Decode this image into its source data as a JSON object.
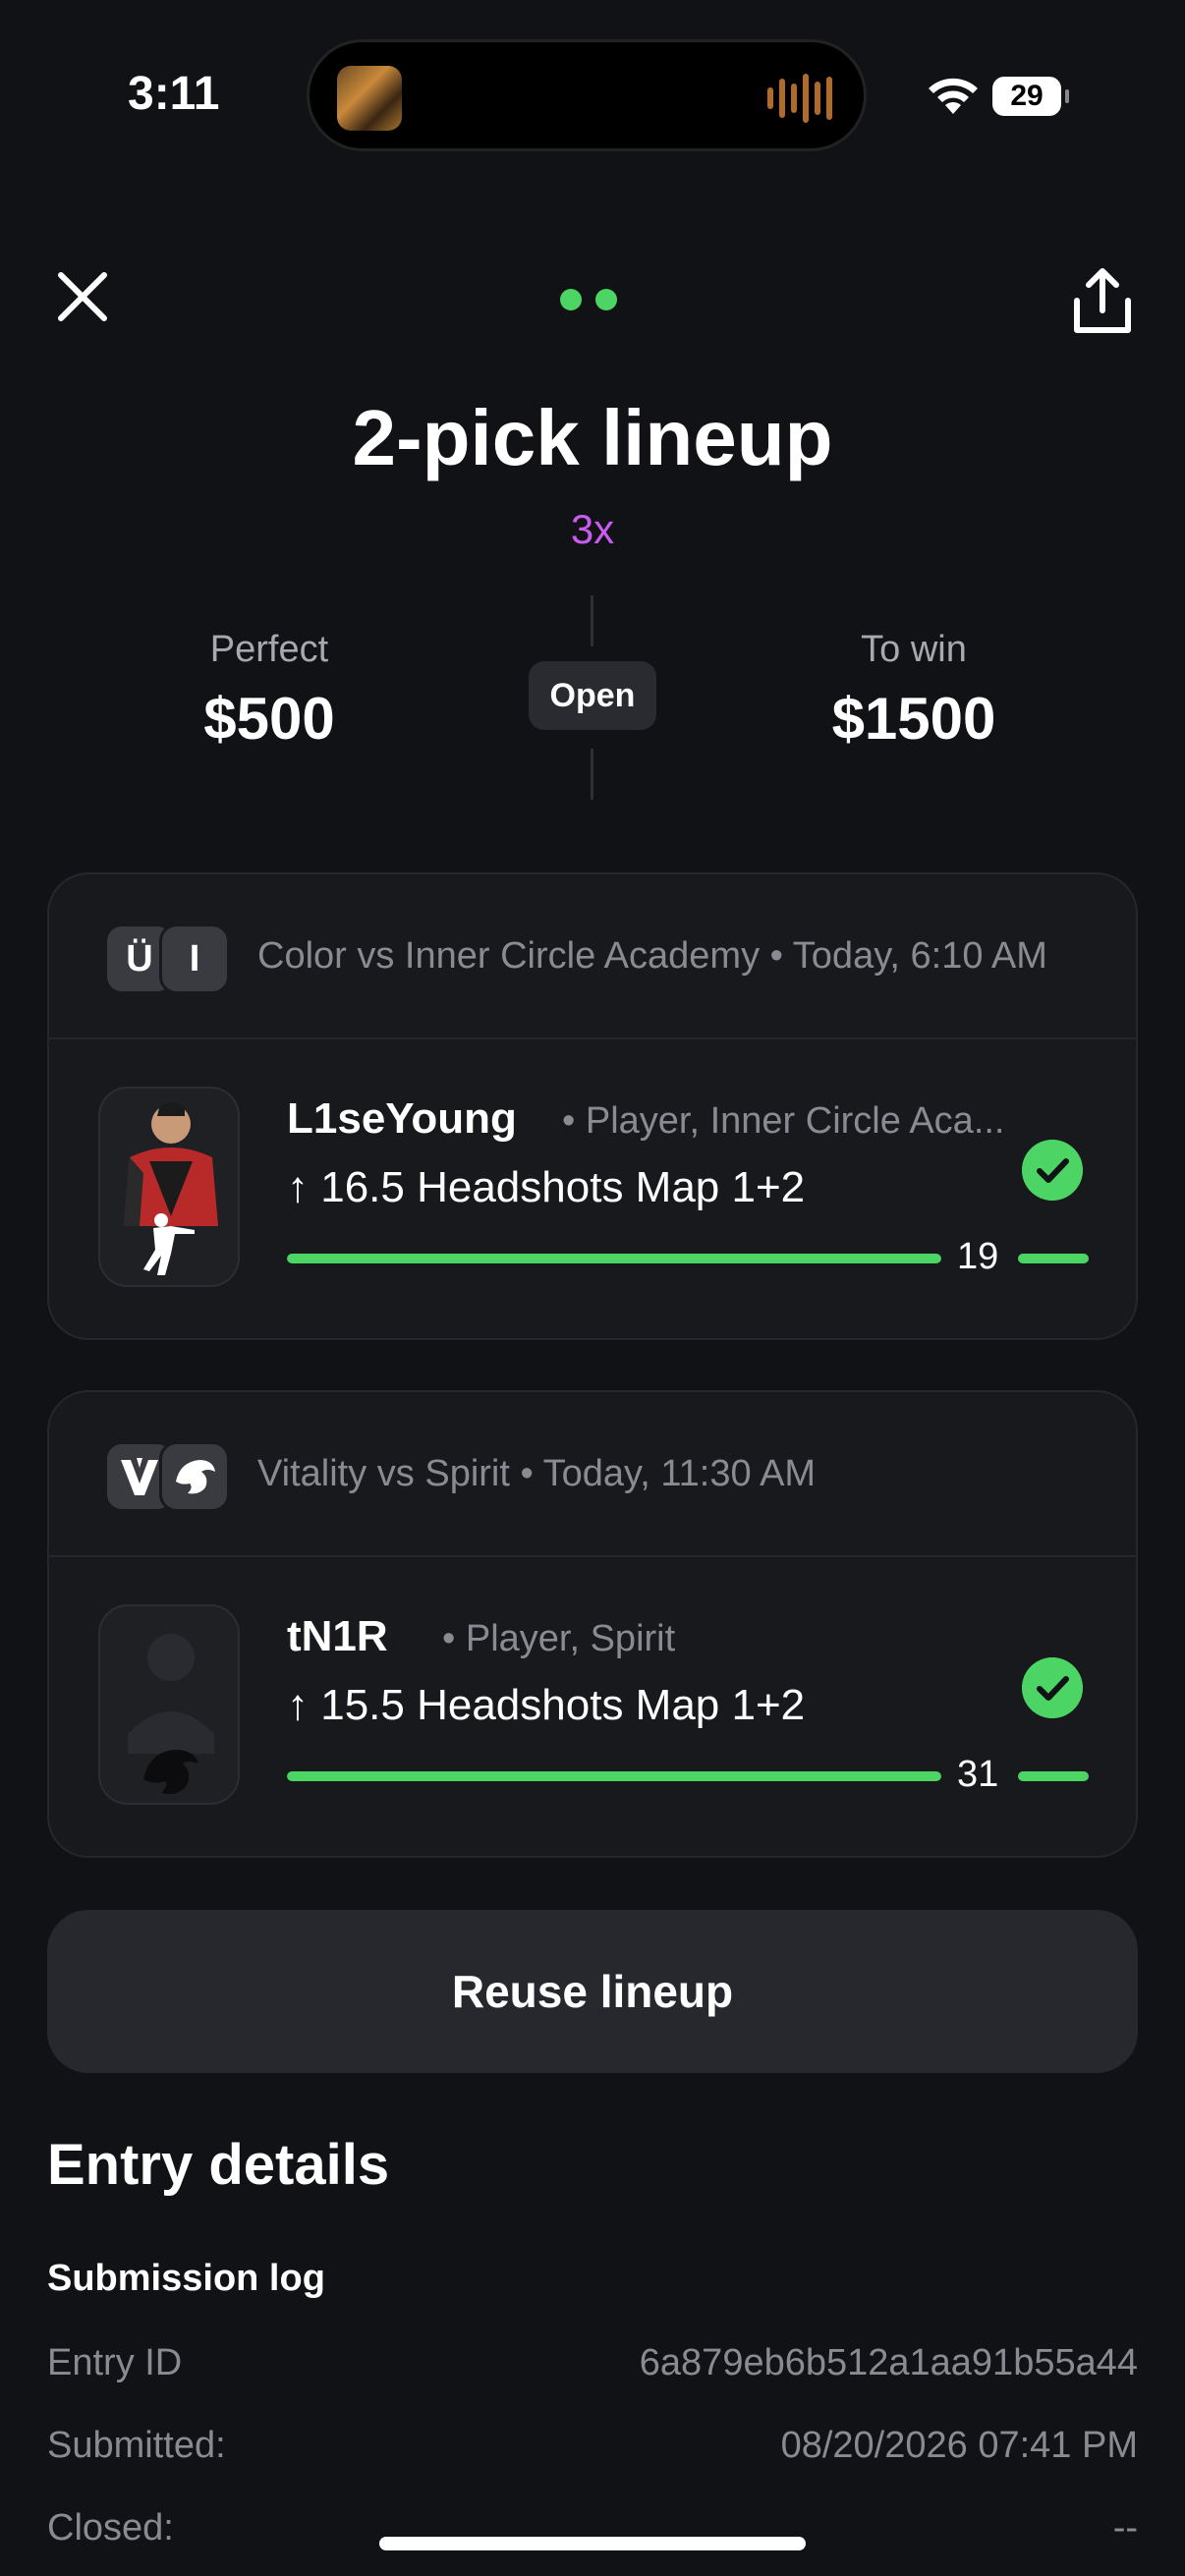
{
  "status_bar": {
    "time": "3:11",
    "battery": "29"
  },
  "header": {
    "title": "2-pick lineup",
    "multiplier": "3x"
  },
  "stats": {
    "perfect_label": "Perfect",
    "perfect_value": "$500",
    "status": "Open",
    "to_win_label": "To win",
    "to_win_value": "$1500"
  },
  "picks": [
    {
      "match": "Color vs Inner Circle Academy • Today, 6:10 AM",
      "team_logos": [
        "Ü",
        "I"
      ],
      "player": "L1seYoung",
      "meta": "• Player, Inner Circle Aca...",
      "prop": "↑ 16.5 Headshots Map 1+2",
      "result": "19",
      "progress_fraction": 1.0,
      "hit": true
    },
    {
      "match": "Vitality vs Spirit • Today, 11:30 AM",
      "team_logos": [
        "vitality-logo-icon",
        "spirit-dragon-icon"
      ],
      "player": "tN1R",
      "meta": "• Player, Spirit",
      "prop": "↑ 15.5 Headshots Map 1+2",
      "result": "31",
      "progress_fraction": 1.0,
      "hit": true
    }
  ],
  "actions": {
    "reuse_label": "Reuse lineup"
  },
  "entry_details": {
    "title": "Entry details",
    "log_title": "Submission log",
    "rows": [
      {
        "label": "Entry ID",
        "value": "6a879eb6b512a1aa91b55a44"
      },
      {
        "label": "Submitted:",
        "value": "08/20/2026 07:41 PM"
      },
      {
        "label": "Closed:",
        "value": "--"
      }
    ]
  },
  "colors": {
    "accent_green": "#4cd464",
    "multiplier_purple": "#c85cf0",
    "background": "#111215",
    "card": "#18191d"
  }
}
